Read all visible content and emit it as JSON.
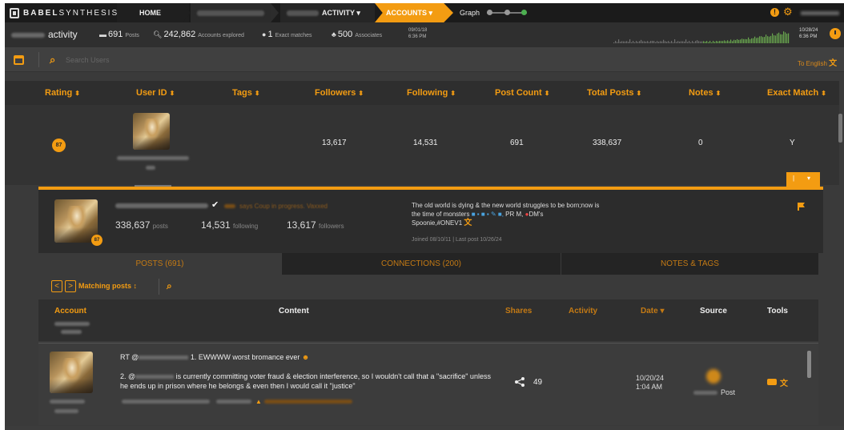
{
  "nav": {
    "logo_bold": "BABEL",
    "logo_light": "SYNTHESIS",
    "home": "HOME",
    "activity": "ACTIVITY ▾",
    "accounts": "ACCOUNTS ▾",
    "graph": "Graph"
  },
  "stats": {
    "label": "activity",
    "posts_value": "691",
    "posts_label": "Posts",
    "accounts_value": "242,862",
    "accounts_label": "Accounts explored",
    "exact_value": "1",
    "exact_label": "Exact matches",
    "associates_value": "500",
    "associates_label": "Associates",
    "date_left_line1": "09/01/18",
    "date_left_line2": "6:36 PM",
    "date_right_line1": "10/28/24",
    "date_right_line2": "6:36 PM"
  },
  "search": {
    "placeholder": "Search Users",
    "lang_link": "To English"
  },
  "users_table": {
    "headers": [
      "Rating",
      "User ID",
      "Tags",
      "Followers",
      "Following",
      "Post Count",
      "Total Posts",
      "Notes",
      "Exact Match"
    ],
    "row": {
      "rating": "87",
      "followers": "13,617",
      "following": "14,531",
      "post_count": "691",
      "total_posts": "338,637",
      "notes": "0",
      "exact_match": "Y"
    }
  },
  "detail": {
    "badge": "87",
    "status_text": "says Coup in progress. Vaxxed",
    "posts_value": "338,637",
    "posts_label": "posts",
    "following_value": "14,531",
    "following_label": "following",
    "followers_value": "13,617",
    "followers_label": "followers",
    "bio_line1": "The old world is dying & the new world struggles to be born;now is",
    "bio_line2": "the time of monsters",
    "bio_line2_tail": "PR M,",
    "bio_line2_end": "DM's",
    "bio_line3": "Spoonie,#ONEV1",
    "joined": "Joined 08/10/11  |  Last post 10/26/24"
  },
  "tabs": [
    {
      "label": "POSTS (691)"
    },
    {
      "label": "CONNECTIONS (200)"
    },
    {
      "label": "NOTES & TAGS"
    }
  ],
  "posts_toolbar": {
    "prev": "<",
    "next": ">",
    "matching": "Matching posts ↕"
  },
  "posts_table": {
    "headers": {
      "account": "Account",
      "content": "Content",
      "shares": "Shares",
      "activity": "Activity",
      "date": "Date ▾",
      "source": "Source",
      "tools": "Tools"
    },
    "row": {
      "line1_prefix": "RT @",
      "line1_suffix": "1. EWWWW worst bromance ever",
      "line2_prefix": "2. @",
      "line2_rest": "is currently committing voter fraud & election interference, so I wouldn't call that a \"sacrifice\" unless he ends up in prison where he belongs & even then I would call it \"justice\"",
      "shares": "49",
      "date_line1": "10/20/24",
      "date_line2": "1:04 AM",
      "source": "Post"
    }
  },
  "colors": {
    "accent": "#f39c12",
    "background": "#3a3a3a",
    "nav": "#1b1b1b",
    "spark": "#6aa84f"
  },
  "icons": [
    "logo-icon",
    "info-icon",
    "gear-icon",
    "chat-icon",
    "search-icon",
    "user-icon",
    "associates-icon",
    "clock-icon",
    "calendar-icon",
    "translate-icon",
    "check-icon",
    "flag-icon",
    "share-icon",
    "warning-icon"
  ]
}
